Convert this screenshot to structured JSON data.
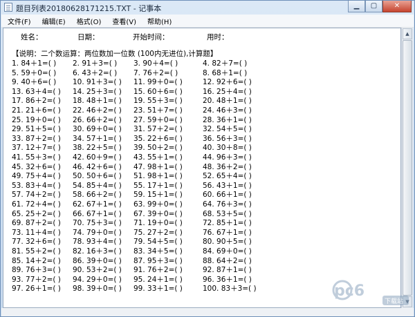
{
  "window": {
    "title": "题目列表20180628171215.TXT - 记事本"
  },
  "menu": [
    "文件(F)",
    "编辑(E)",
    "格式(O)",
    "查看(V)",
    "帮助(H)"
  ],
  "document": {
    "header_fields": [
      "姓名：",
      "日期：",
      "开始时间：",
      "用时："
    ],
    "instruction": "【说明：二个数运算：两位数加一位数 (100内无进位),计算题】",
    "rows": [
      [
        "1. 84＋1=(      )",
        "2. 91＋3=(      )",
        "3. 90＋4=(      )",
        "4. 82＋7=(      )"
      ],
      [
        "5. 59＋0=(      )",
        "6. 43＋2=(      )",
        "7. 76＋2=(      )",
        "8. 68＋1=(      )"
      ],
      [
        "9. 40＋6=(      )",
        "10. 91＋3=(      )",
        "11. 99＋0=(      )",
        "12. 92＋6=(      )"
      ],
      [
        "13. 63＋4=(      )",
        "14. 25＋3=(      )",
        "15. 60＋6=(      )",
        "16. 25＋4=(      )"
      ],
      [
        "17. 86＋2=(      )",
        "18. 48＋1=(      )",
        "19. 55＋3=(      )",
        "20. 48＋1=(      )"
      ],
      [
        "21. 21＋6=(      )",
        "22. 46＋2=(      )",
        "23. 51＋7=(      )",
        "24. 46＋3=(      )"
      ],
      [
        "25. 19＋0=(      )",
        "26. 66＋2=(      )",
        "27. 59＋0=(      )",
        "28. 36＋1=(      )"
      ],
      [
        "29. 51＋5=(      )",
        "30. 69＋0=(      )",
        "31. 57＋2=(      )",
        "32. 54＋5=(      )"
      ],
      [
        "33. 87＋2=(      )",
        "34. 57＋1=(      )",
        "35. 22＋6=(      )",
        "36. 56＋3=(      )"
      ],
      [
        "37. 12＋7=(      )",
        "38. 22＋5=(      )",
        "39. 50＋2=(      )",
        "40. 30＋8=(      )"
      ],
      [
        "41. 55＋3=(      )",
        "42. 60＋9=(      )",
        "43. 55＋1=(      )",
        "44. 96＋3=(      )"
      ],
      [
        "45. 32＋6=(      )",
        "46. 42＋6=(      )",
        "47. 98＋1=(      )",
        "48. 36＋2=(      )"
      ],
      [
        "49. 75＋4=(      )",
        "50. 50＋6=(      )",
        "51. 98＋1=(      )",
        "52. 65＋4=(      )"
      ],
      [
        "53. 83＋4=(      )",
        "54. 85＋4=(      )",
        "55. 17＋1=(      )",
        "56. 43＋1=(      )"
      ],
      [
        "57. 74＋2=(      )",
        "58. 66＋2=(      )",
        "59. 15＋1=(      )",
        "60. 66＋1=(      )"
      ],
      [
        "61. 72＋4=(      )",
        "62. 67＋1=(      )",
        "63. 99＋0=(      )",
        "64. 76＋3=(      )"
      ],
      [
        "65. 25＋2=(      )",
        "66. 67＋1=(      )",
        "67. 39＋0=(      )",
        "68. 53＋5=(      )"
      ],
      [
        "69. 87＋2=(      )",
        "70. 75＋3=(      )",
        "71. 19＋0=(      )",
        "72. 85＋1=(      )"
      ],
      [
        "73. 11＋4=(      )",
        "74. 79＋0=(      )",
        "75. 27＋2=(      )",
        "76. 67＋1=(      )"
      ],
      [
        "77. 32＋6=(      )",
        "78. 93＋4=(      )",
        "79. 54＋5=(      )",
        "80. 90＋5=(      )"
      ],
      [
        "81. 55＋2=(      )",
        "82. 16＋3=(      )",
        "83. 34＋5=(      )",
        "84. 69＋0=(      )"
      ],
      [
        "85. 14＋2=(      )",
        "86. 39＋0=(      )",
        "87. 95＋3=(      )",
        "88. 64＋2=(      )"
      ],
      [
        "89. 76＋3=(      )",
        "90. 53＋2=(      )",
        "91. 76＋2=(      )",
        "92. 87＋1=(      )"
      ],
      [
        "93. 77＋2=(      )",
        "94. 29＋0=(      )",
        "95. 24＋1=(      )",
        "96. 36＋1=(      )"
      ],
      [
        "97. 26＋1=(      )",
        "98. 39＋0=(      )",
        "99. 33＋1=(      )",
        "100. 83＋3=(      )"
      ]
    ]
  },
  "watermark": {
    "text": "pc6",
    "sub": "下载站"
  }
}
